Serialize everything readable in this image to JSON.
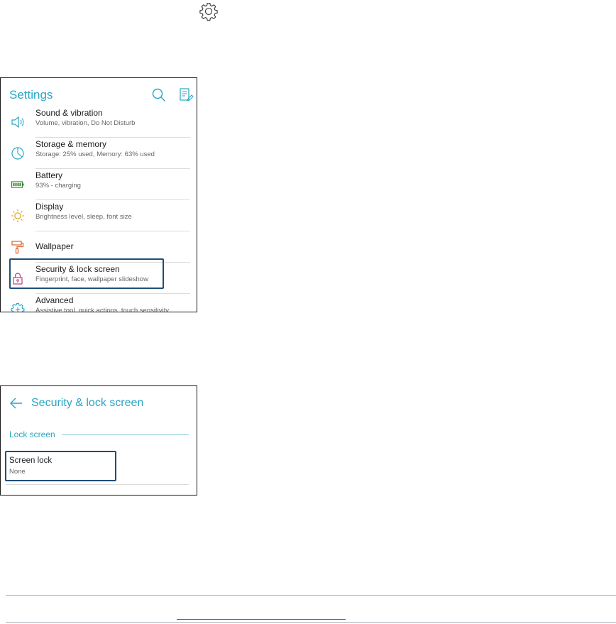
{
  "settings": {
    "title": "Settings",
    "items": [
      {
        "label": "Sound & vibration",
        "sub": "Volume, vibration, Do Not Disturb"
      },
      {
        "label": "Storage & memory",
        "sub": "Storage: 25% used, Memory: 63% used"
      },
      {
        "label": "Battery",
        "sub": "93% - charging"
      },
      {
        "label": "Display",
        "sub": "Brightness level, sleep, font size"
      },
      {
        "label": "Wallpaper",
        "sub": ""
      },
      {
        "label": "Security & lock screen",
        "sub": "Fingerprint, face, wallpaper slideshow"
      },
      {
        "label": "Advanced",
        "sub": "Assistive tool, quick actions, touch sensitivity"
      }
    ]
  },
  "security": {
    "title": "Security & lock screen",
    "section": "Lock screen",
    "screen_lock_label": "Screen lock",
    "screen_lock_value": "None"
  },
  "colors": {
    "accent": "#29a5c4",
    "highlight_box": "#1f4e79",
    "battery": "#2e8b2e",
    "display": "#e0a020",
    "wallpaper": "#d9622b",
    "security": "#c4407a"
  },
  "icons": [
    "gear-icon",
    "search-icon",
    "edit-icon",
    "speaker-icon",
    "storage-icon",
    "battery-icon",
    "display-icon",
    "wallpaper-icon",
    "lock-icon",
    "advanced-gear-icon",
    "back-arrow-icon"
  ]
}
